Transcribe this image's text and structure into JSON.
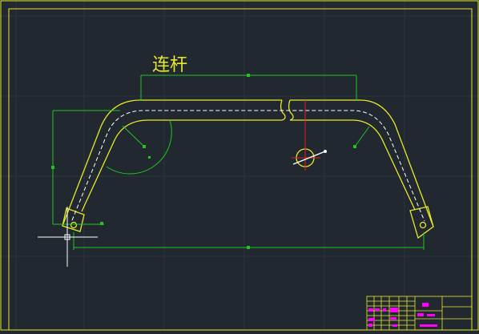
{
  "drawing": {
    "title_text": "连杆"
  },
  "colors": {
    "background": "#212830",
    "grid": "#2b333d",
    "outline": "#e8e82a",
    "frame": "#e8e82a",
    "dimension": "#21c521",
    "centerline": "#ffffff",
    "axis": "#e02020",
    "crosshair": "#ffffff",
    "title_block_fill": "#ff00ff"
  },
  "icons": {
    "cursor": "crosshair-cursor-icon"
  }
}
